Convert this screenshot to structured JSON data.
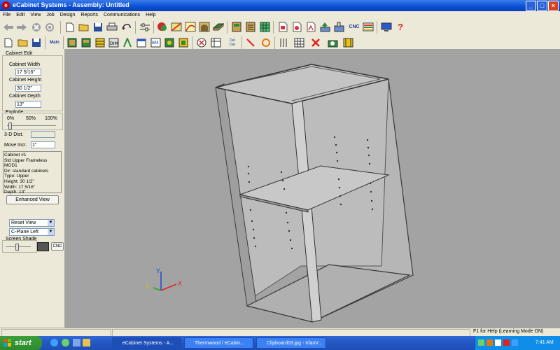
{
  "window": {
    "title": "eCabinet Systems - Assembly: Untitled",
    "app_icon": "ecabinet-app-icon"
  },
  "window_controls": {
    "minimize": "_",
    "maximize": "□",
    "close": "×"
  },
  "menu": [
    "File",
    "Edit",
    "View",
    "Job",
    "Design",
    "Reports",
    "Communications",
    "Help"
  ],
  "toolbar_text": {
    "cnc": "CNC",
    "help": "?",
    "main": "Main",
    "dat": "Dat",
    "del": "Del"
  },
  "cabinet_edit": {
    "group_label": "Cabinet Edit",
    "width_label": "Cabinet Width",
    "width_value": "17 5/16\"",
    "height_label": "Cabinet Height",
    "height_value": "30 1/2\"",
    "depth_label": "Cabinet Depth",
    "depth_value": "13\""
  },
  "explode": {
    "group_label": "Explode",
    "tick_0": "0%",
    "tick_50": "50%",
    "tick_100": "100%"
  },
  "dist_label": "3-D Dist.",
  "dist_value": "",
  "move_label": "Move Incr.",
  "move_value": "1\"",
  "info_lines": [
    "Cabinet #1",
    "Std Upper Frameless MOD1",
    "Dir: standard cabinets",
    "Type: Upper",
    "Height: 30 1/2\"",
    "Width: 17 5/16\"",
    "Depth: 13\""
  ],
  "enhanced_view_label": "Enhanced View",
  "reset_view": "Reset View",
  "cplane": "C-Plane Left",
  "screen_shade_label": "Screen Shade",
  "cnc_label": "CNC",
  "axis": {
    "x": "X",
    "y": "Y",
    "z": "Z"
  },
  "status": {
    "help_text": "F1 for Help (Learning Mode ON)"
  },
  "taskbar": {
    "start": "start",
    "tasks": [
      "eCabinet Systems - A...",
      "Thermwood / eCabin...",
      "Clipboard03.jpg - IrfanV..."
    ],
    "clock": "7:41 AM"
  },
  "colors": {
    "titlebar": "#0a4fd6",
    "viewport": "#a3a3a3",
    "taskbar": "#2458c6",
    "start": "#2e8b2e"
  }
}
